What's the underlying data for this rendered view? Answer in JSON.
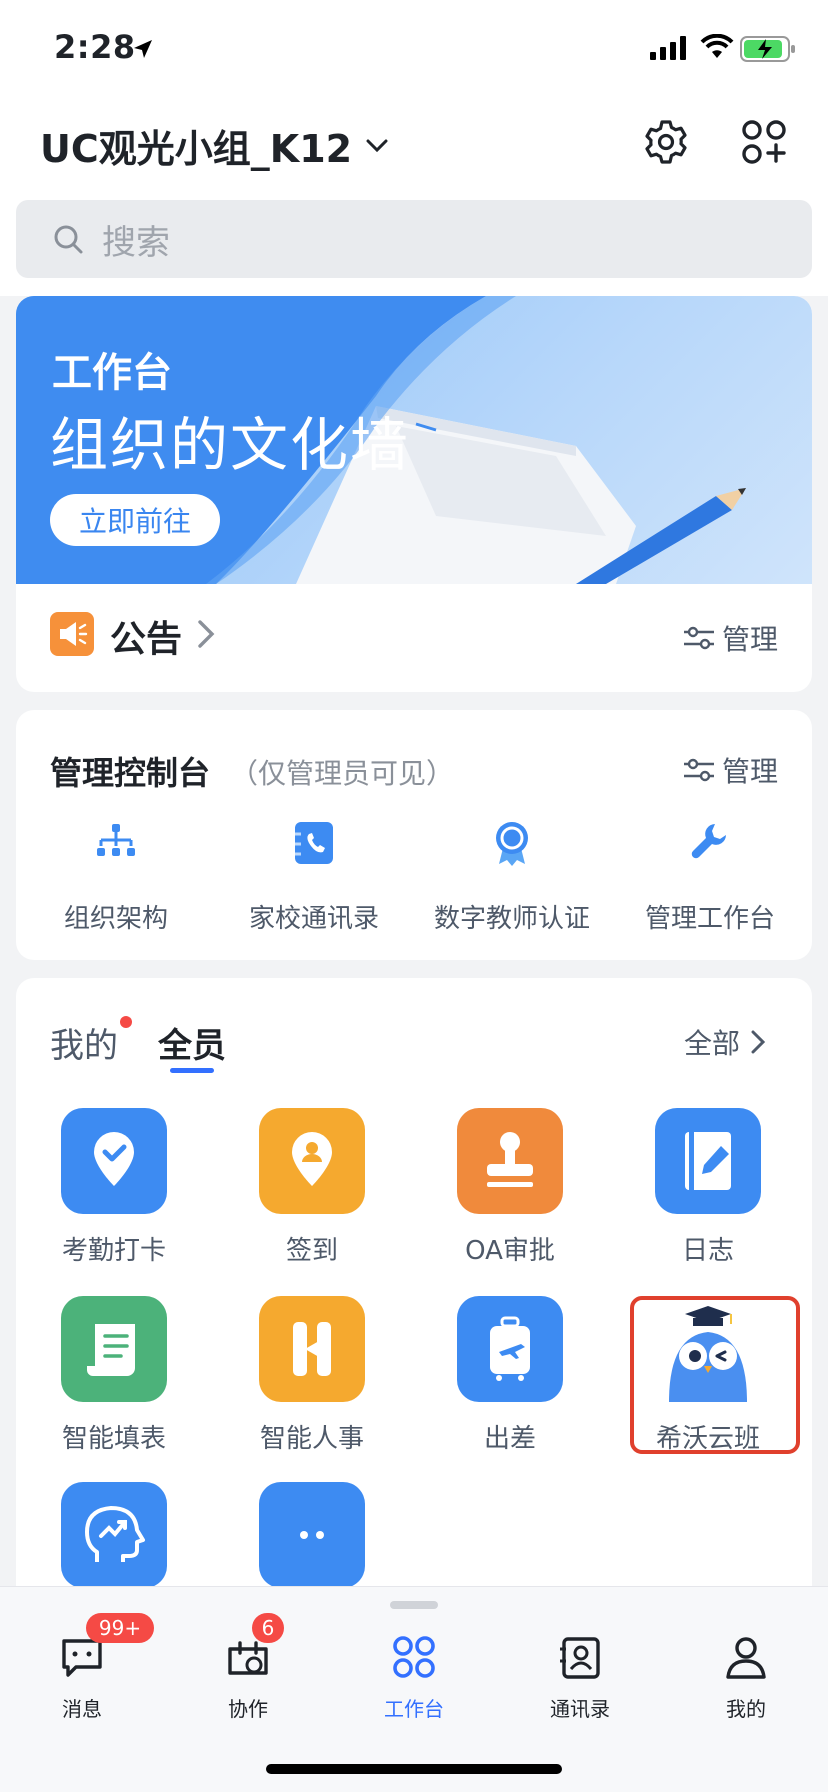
{
  "status": {
    "time": "2:28"
  },
  "header": {
    "org_title": "UC观光小组_K12"
  },
  "search": {
    "placeholder": "搜索"
  },
  "banner": {
    "small_title": "工作台",
    "big_title": "组织的文化墙",
    "button": "立即前往"
  },
  "notice": {
    "label": "公告",
    "manage": "管理"
  },
  "admin": {
    "title": "管理控制台",
    "subtitle": "（仅管理员可见）",
    "manage": "管理",
    "items": [
      {
        "label": "组织架构",
        "icon": "org-chart-icon"
      },
      {
        "label": "家校通讯录",
        "icon": "phone-book-icon"
      },
      {
        "label": "数字教师认证",
        "icon": "badge-medal-icon"
      },
      {
        "label": "管理工作台",
        "icon": "wrench-icon"
      }
    ]
  },
  "apps": {
    "tabs": [
      {
        "label": "我的"
      },
      {
        "label": "全员"
      }
    ],
    "all_link": "全部",
    "items": [
      {
        "label": "考勤打卡",
        "color": "#3d8bf2"
      },
      {
        "label": "签到",
        "color": "#f5a92f"
      },
      {
        "label": "OA审批",
        "color": "#f08a3c"
      },
      {
        "label": "日志",
        "color": "#3d8bf2"
      },
      {
        "label": "智能填表",
        "color": "#4cb27a"
      },
      {
        "label": "智能人事",
        "color": "#f5a92f"
      },
      {
        "label": "出差",
        "color": "#3d8bf2"
      },
      {
        "label": "希沃云班",
        "color": "#4a8ff0"
      },
      {
        "label": "",
        "color": "#3d8bf2"
      },
      {
        "label": "",
        "color": "#3d8bf2"
      }
    ]
  },
  "tabbar": {
    "items": [
      {
        "label": "消息",
        "badge": "99+"
      },
      {
        "label": "协作",
        "badge": "6"
      },
      {
        "label": "工作台",
        "badge": ""
      },
      {
        "label": "通讯录",
        "badge": ""
      },
      {
        "label": "我的",
        "badge": ""
      }
    ],
    "active_color": "#3370ff"
  }
}
